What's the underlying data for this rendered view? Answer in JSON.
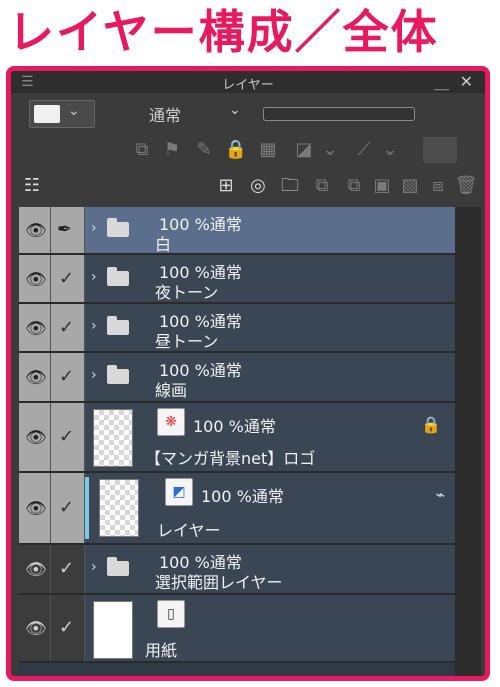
{
  "heading": "レイヤー構成／全体",
  "window": {
    "title": "レイヤー",
    "menu_icon": "hamburger-icon",
    "minimize_icon": "minimize-icon",
    "close_icon": "close-icon"
  },
  "toolbar": {
    "blend_mode": "通常",
    "color_swatch": "#f0f0f0"
  },
  "layers": [
    {
      "opacity_mode": "100 %通常",
      "name": "白",
      "type": "folder",
      "selected": true
    },
    {
      "opacity_mode": "100 %通常",
      "name": "夜トーン",
      "type": "folder"
    },
    {
      "opacity_mode": "100 %通常",
      "name": "昼トーン",
      "type": "folder"
    },
    {
      "opacity_mode": "100 %通常",
      "name": "線画",
      "type": "folder"
    },
    {
      "opacity_mode": "100 %通常",
      "name": "【マンガ背景net】ロゴ",
      "type": "image",
      "locked": true
    },
    {
      "opacity_mode": "100 %通常",
      "name": "レイヤー",
      "type": "raster",
      "active": true
    },
    {
      "opacity_mode": "100 %通常",
      "name": "選択範囲レイヤー",
      "type": "folder"
    },
    {
      "opacity_mode": "",
      "name": "用紙",
      "type": "paper"
    }
  ],
  "colors": {
    "accent": "#e8195e",
    "selected_row": "#5b6f8d",
    "row_bg": "#3a4654"
  }
}
